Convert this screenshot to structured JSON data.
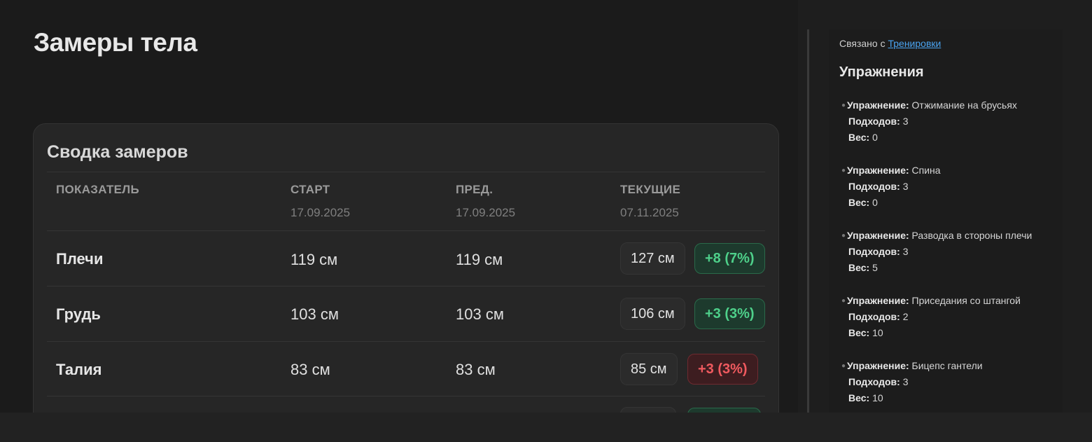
{
  "page": {
    "title": "Замеры тела"
  },
  "summary": {
    "title": "Сводка замеров",
    "columns": [
      {
        "label": "Показатель",
        "date": ""
      },
      {
        "label": "Старт",
        "date": "17.09.2025"
      },
      {
        "label": "Пред.",
        "date": "17.09.2025"
      },
      {
        "label": "Текущие",
        "date": "07.11.2025"
      }
    ],
    "rows": [
      {
        "name": "Плечи",
        "start": "119 см",
        "prev": "119 см",
        "current": "127 см",
        "delta": "+8 (7%)",
        "delta_color": "#4ed08a"
      },
      {
        "name": "Грудь",
        "start": "103 см",
        "prev": "103 см",
        "current": "106 см",
        "delta": "+3 (3%)",
        "delta_color": "#4ed08a"
      },
      {
        "name": "Талия",
        "start": "83 см",
        "prev": "83 см",
        "current": "85 см",
        "delta": "+3 (3%)",
        "delta_color": "#f05a5f"
      }
    ]
  },
  "sidebar": {
    "related_prefix": "Связано с",
    "related_link": "Тренировки",
    "heading": "Упражнения",
    "labels": {
      "exercise": "Упражнение:",
      "sets": "Подходов:",
      "weight": "Вес:"
    },
    "exercises": [
      {
        "name": "Отжимание на брусьях",
        "sets": "3",
        "weight": "0"
      },
      {
        "name": "Спина",
        "sets": "3",
        "weight": "0"
      },
      {
        "name": "Разводка в стороны плечи",
        "sets": "3",
        "weight": "5"
      },
      {
        "name": "Приседания со штангой",
        "sets": "2",
        "weight": "10"
      },
      {
        "name": "Бицепс гантели",
        "sets": "3",
        "weight": "10"
      }
    ]
  }
}
